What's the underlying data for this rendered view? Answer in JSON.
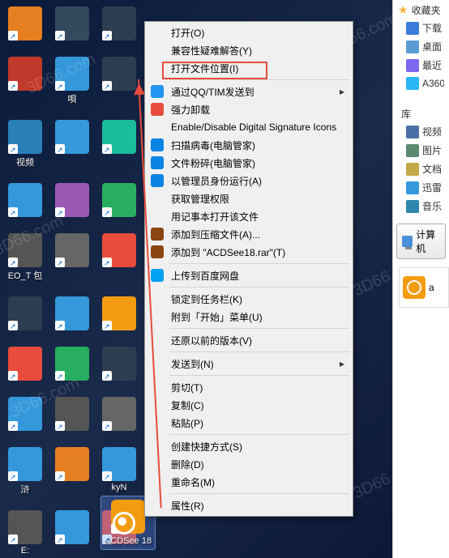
{
  "watermarks": [
    "3D66.com",
    "3D66.com",
    "3D66.com",
    "3D66.com",
    "3D66.com",
    "3D66.com"
  ],
  "desktop_icons": [
    {
      "label": "",
      "color": "#e67e22"
    },
    {
      "label": "",
      "color": "#34495e"
    },
    {
      "label": "",
      "color": "#2c3e50"
    },
    {
      "label": "",
      "color": "#c0392b"
    },
    {
      "label": "唄",
      "color": "#3498db"
    },
    {
      "label": "",
      "color": "#2c3e50"
    },
    {
      "label": "视频",
      "color": "#2980b9"
    },
    {
      "label": "",
      "color": "#3498db"
    },
    {
      "label": "",
      "color": "#1abc9c"
    },
    {
      "label": "",
      "color": "#3498db"
    },
    {
      "label": "",
      "color": "#9b59b6"
    },
    {
      "label": "",
      "color": "#27ae60"
    },
    {
      "label": "EO_T 包",
      "color": "#555"
    },
    {
      "label": "",
      "color": "#666"
    },
    {
      "label": "",
      "color": "#e74c3c"
    },
    {
      "label": "",
      "color": "#2c3e50"
    },
    {
      "label": "",
      "color": "#3498db"
    },
    {
      "label": "",
      "color": "#f39c12"
    },
    {
      "label": "",
      "color": "#e74c3c"
    },
    {
      "label": "",
      "color": "#27ae60"
    },
    {
      "label": "",
      "color": "#2c3e50"
    },
    {
      "label": "",
      "color": "#3498db"
    },
    {
      "label": "",
      "color": "#555"
    },
    {
      "label": "",
      "color": "#666"
    },
    {
      "label": "浒",
      "color": "#3498db"
    },
    {
      "label": "",
      "color": "#e67e22"
    },
    {
      "label": "kyN",
      "color": "#3498db"
    },
    {
      "label": "E:",
      "color": "#555"
    },
    {
      "label": "",
      "color": "#3498db"
    },
    {
      "label": "",
      "color": "#e74c3c"
    }
  ],
  "acdsee_label": "ACDSee 18",
  "context_menu": {
    "items": [
      {
        "text": "打开(O)",
        "icon": null
      },
      {
        "text": "兼容性疑难解答(Y)",
        "icon": null
      },
      {
        "text": "打开文件位置(I)",
        "icon": null,
        "highlighted": true
      },
      {
        "sep": true
      },
      {
        "text": "通过QQ/TIM发送到",
        "icon": "#2095f2",
        "sub": true
      },
      {
        "text": "强力卸载",
        "icon": "#e74c3c"
      },
      {
        "text": "Enable/Disable Digital Signature Icons",
        "icon": null
      },
      {
        "text": "扫描病毒(电脑管家)",
        "icon": "#0984e3"
      },
      {
        "text": "文件粉碎(电脑管家)",
        "icon": "#0984e3"
      },
      {
        "text": "以管理员身份运行(A)",
        "icon": "#0984e3"
      },
      {
        "text": "获取管理权限",
        "icon": null
      },
      {
        "text": "用记事本打开该文件",
        "icon": null
      },
      {
        "text": "添加到压缩文件(A)...",
        "icon": "#8b4513"
      },
      {
        "text": "添加到 \"ACDSee18.rar\"(T)",
        "icon": "#8b4513"
      },
      {
        "sep": true
      },
      {
        "text": "上传到百度网盘",
        "icon": "#00a1f1"
      },
      {
        "sep": true
      },
      {
        "text": "锁定到任务栏(K)",
        "icon": null
      },
      {
        "text": "附到「开始」菜单(U)",
        "icon": null
      },
      {
        "sep": true
      },
      {
        "text": "还原以前的版本(V)",
        "icon": null
      },
      {
        "sep": true
      },
      {
        "text": "发送到(N)",
        "icon": null,
        "sub": true
      },
      {
        "sep": true
      },
      {
        "text": "剪切(T)",
        "icon": null
      },
      {
        "text": "复制(C)",
        "icon": null
      },
      {
        "text": "粘贴(P)",
        "icon": null
      },
      {
        "sep": true
      },
      {
        "text": "创建快捷方式(S)",
        "icon": null
      },
      {
        "text": "删除(D)",
        "icon": null
      },
      {
        "text": "重命名(M)",
        "icon": null
      },
      {
        "sep": true
      },
      {
        "text": "属性(R)",
        "icon": null
      }
    ]
  },
  "sidebar": {
    "favorites_title": "收藏夹",
    "favorites": [
      {
        "label": "下载",
        "color": "#3b7dd8"
      },
      {
        "label": "桌面",
        "color": "#5b9bd5"
      },
      {
        "label": "最近",
        "color": "#7b68ee"
      },
      {
        "label": "A360",
        "color": "#29b6f6"
      }
    ],
    "library_title": "库",
    "library": [
      {
        "label": "视频",
        "color": "#4a6fa5"
      },
      {
        "label": "图片",
        "color": "#5b8a72"
      },
      {
        "label": "文档",
        "color": "#c4a747"
      },
      {
        "label": "迅雷",
        "color": "#3498db"
      },
      {
        "label": "音乐",
        "color": "#2e86ab"
      }
    ],
    "computer_label": "计算机",
    "acd_label": "a"
  }
}
